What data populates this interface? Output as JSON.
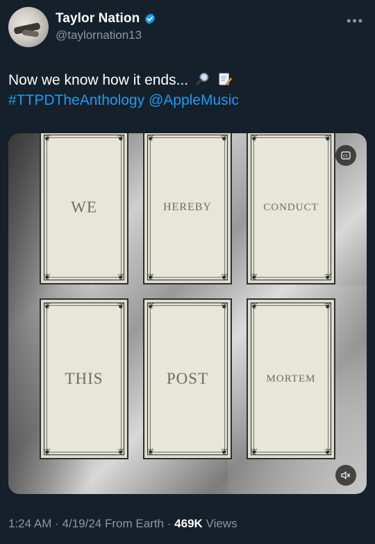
{
  "user": {
    "display_name": "Taylor Nation",
    "handle": "@taylornation13"
  },
  "tweet": {
    "text": "Now we know how it ends...",
    "emojis": [
      "magnifying-glass-icon",
      "memo-icon"
    ],
    "hashtag": "#TTPDTheAnthology",
    "mention": "@AppleMusic"
  },
  "media": {
    "cards": [
      "WE",
      "HEREBY",
      "CONDUCT",
      "THIS",
      "POST",
      "MORTEM"
    ],
    "controls": [
      "gif-badge-icon",
      "mute-icon"
    ]
  },
  "meta": {
    "time": "1:24 AM",
    "date": "4/19/24",
    "source": "From Earth",
    "views_count": "469K",
    "views_label": "Views",
    "sep": "·"
  },
  "colors": {
    "background": "#15202b",
    "link": "#1d9bf0",
    "muted": "#8b98a5",
    "verified": "#1d9bf0"
  }
}
